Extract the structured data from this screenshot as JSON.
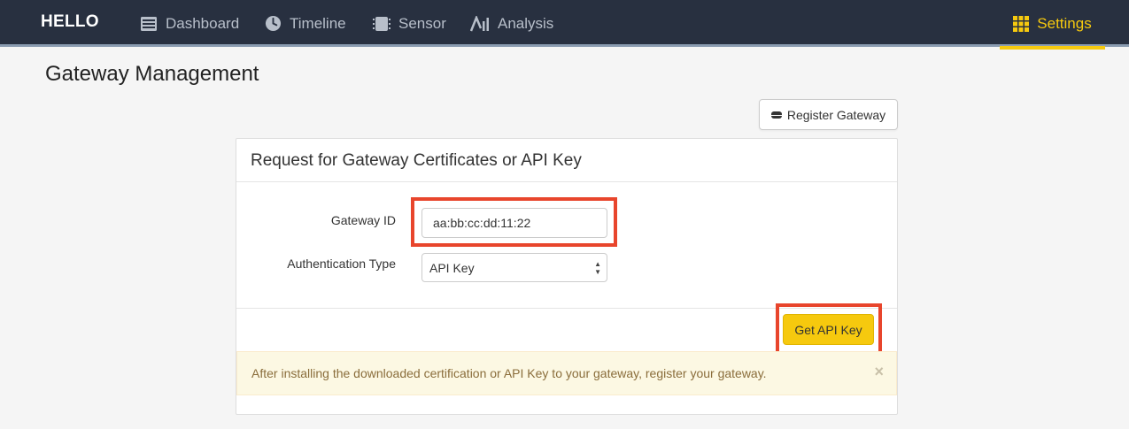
{
  "navbar": {
    "brand": "HELLO",
    "items": [
      {
        "label": "Dashboard",
        "icon": "dashboard-icon"
      },
      {
        "label": "Timeline",
        "icon": "clock-icon"
      },
      {
        "label": "Sensor",
        "icon": "chip-icon"
      },
      {
        "label": "Analysis",
        "icon": "analysis-icon"
      }
    ],
    "settings": {
      "label": "Settings",
      "icon": "grid-icon"
    }
  },
  "page": {
    "title": "Gateway Management",
    "register_button": "Register Gateway"
  },
  "panel": {
    "heading": "Request for Gateway Certificates or API Key",
    "gateway_id_label": "Gateway ID",
    "gateway_id_value": "aa:bb:cc:dd:11:22",
    "auth_type_label": "Authentication Type",
    "auth_type_selected": "API Key",
    "get_key_button": "Get API Key",
    "alert_text": "After installing the downloaded certification or API Key to your gateway, register your gateway.",
    "alert_close": "×"
  },
  "colors": {
    "navbar_bg": "#283040",
    "accent": "#f6c90e",
    "highlight": "#e8452c",
    "alert_bg": "#fcf8e3"
  }
}
